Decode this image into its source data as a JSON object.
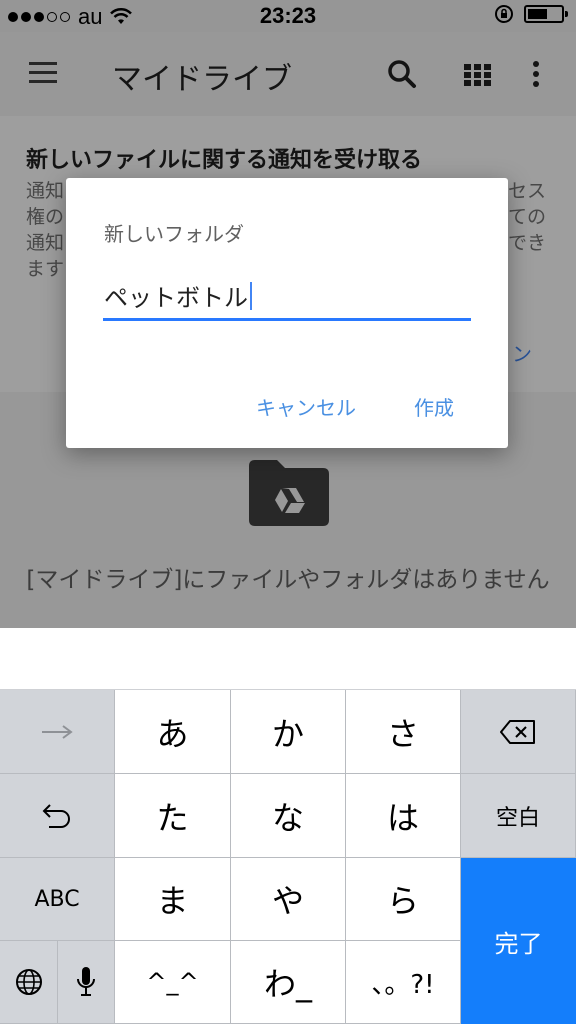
{
  "status_bar": {
    "carrier": "au",
    "time": "23:23",
    "battery_level": 0.6
  },
  "app_bar": {
    "title": "マイドライブ",
    "icons": [
      "menu-icon",
      "search-icon",
      "grid-view-icon",
      "more-vert-icon"
    ]
  },
  "notice": {
    "title": "新しいファイルに関する通知を受け取る",
    "body_lines": [
      "通知",
      "権の",
      "通知",
      "ます"
    ],
    "body_right": [
      "セス",
      "ての",
      "でき"
    ],
    "link_partial": "ン"
  },
  "empty_state": {
    "message": "[マイドライブ]にファイルやフォルダはありません",
    "icon": "drive-folder-icon"
  },
  "dialog": {
    "title": "新しいフォルダ",
    "input_value": "ペットボトル",
    "cancel_label": "キャンセル",
    "create_label": "作成"
  },
  "keyboard": {
    "rows": [
      [
        "→",
        "あ",
        "か",
        "さ",
        "⌫"
      ],
      [
        "↶",
        "た",
        "な",
        "は",
        "空白"
      ],
      [
        "ABC",
        "ま",
        "や",
        "ら",
        "完了"
      ],
      [
        "🌐",
        "🎤",
        "^^",
        "わ_",
        "、。?!"
      ]
    ],
    "labels": {
      "a": "あ",
      "ka": "か",
      "sa": "さ",
      "ta": "た",
      "na": "な",
      "ha": "は",
      "space": "空白",
      "abc": "ABC",
      "ma": "ま",
      "ya": "や",
      "ra": "ら",
      "done": "完了",
      "emoticon": "^_^",
      "wa": "わ_",
      "punct": "、。?!"
    }
  },
  "colors": {
    "accent": "#2979ff",
    "done_key": "#147efb",
    "link": "#4285f4"
  }
}
